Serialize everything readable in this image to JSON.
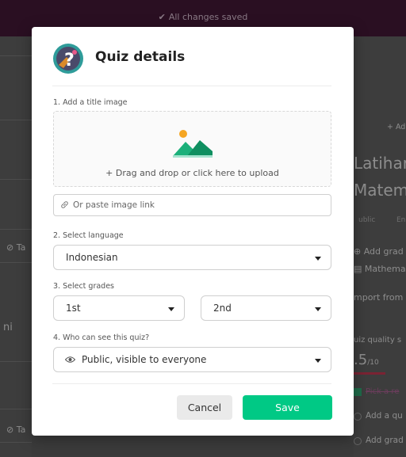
{
  "topbar": {
    "status": "All changes saved",
    "status_icon": "check-icon"
  },
  "background": {
    "left_tags": [
      "Ta",
      "Ta"
    ],
    "left_fragment": "ni",
    "add_label": "+ Ad",
    "quiz_title_1": "Latihar",
    "quiz_title_2": "Matem",
    "meta_visibility": "ublic",
    "meta_lang": "En",
    "add_grade": "Add grad",
    "subject": "Mathema",
    "import_from": "mport from",
    "quality_label": "uiz quality s",
    "quality_score": ".5",
    "quality_total": "/10",
    "checklist": [
      "Pick a re",
      "Add a qu",
      "Add grad"
    ]
  },
  "modal": {
    "title": "Quiz details",
    "icon": "quiz-question-mark-icon",
    "image_section": {
      "label": "1. Add a title image",
      "upload_text": "+ Drag and drop or click here to upload",
      "link_placeholder": "Or paste image link"
    },
    "language": {
      "label": "2. Select language",
      "value": "Indonesian"
    },
    "grades": {
      "label": "3. Select grades",
      "from": "1st",
      "to": "2nd"
    },
    "visibility": {
      "label": "4. Who can see this quiz?",
      "value": "Public, visible to everyone"
    },
    "cancel_label": "Cancel",
    "save_label": "Save"
  },
  "colors": {
    "accent": "#00c985",
    "topbar": "#2a0f22"
  }
}
